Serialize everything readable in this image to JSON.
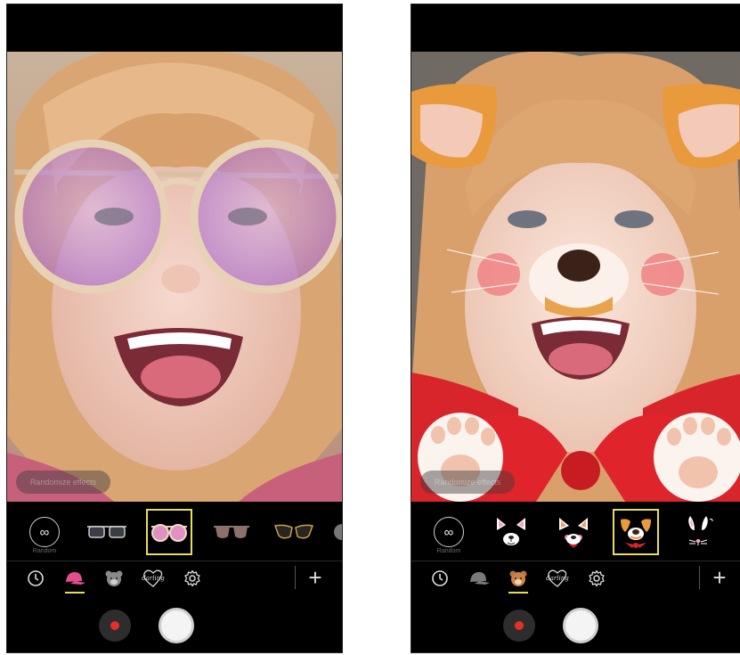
{
  "left": {
    "viewfinder_hint": "Randomize effects",
    "effects": [
      {
        "icon": "random-icon",
        "label": "Random"
      },
      {
        "icon": "dark-sunglasses-icon"
      },
      {
        "icon": "pink-round-sunglasses-icon",
        "selected": true
      },
      {
        "icon": "rose-sunglasses-icon"
      },
      {
        "icon": "cat-eye-sunglasses-icon"
      },
      {
        "icon": "partial-item-icon"
      }
    ],
    "tabs": [
      {
        "icon": "clock-icon",
        "active": false
      },
      {
        "icon": "cap-icon",
        "active": true
      },
      {
        "icon": "bear-icon",
        "active": false
      },
      {
        "icon": "darling-heart-icon",
        "label": "darling",
        "active": false
      },
      {
        "icon": "gear-icon",
        "active": false
      }
    ],
    "add_label": "+"
  },
  "right": {
    "viewfinder_hint": "Randomize effects",
    "effects": [
      {
        "icon": "random-icon",
        "label": "Random"
      },
      {
        "icon": "cat-face-icon"
      },
      {
        "icon": "fox-face-icon"
      },
      {
        "icon": "puppy-face-icon",
        "selected": true
      },
      {
        "icon": "bunny-face-icon"
      }
    ],
    "tabs": [
      {
        "icon": "clock-icon",
        "active": false
      },
      {
        "icon": "cap-icon",
        "active": false
      },
      {
        "icon": "bear-icon",
        "active": true
      },
      {
        "icon": "darling-heart-icon",
        "label": "darling",
        "active": false
      },
      {
        "icon": "gear-icon",
        "active": false
      }
    ],
    "add_label": "+"
  },
  "colors": {
    "accent": "#e8df58",
    "record": "#e5302a",
    "background": "#000000"
  }
}
